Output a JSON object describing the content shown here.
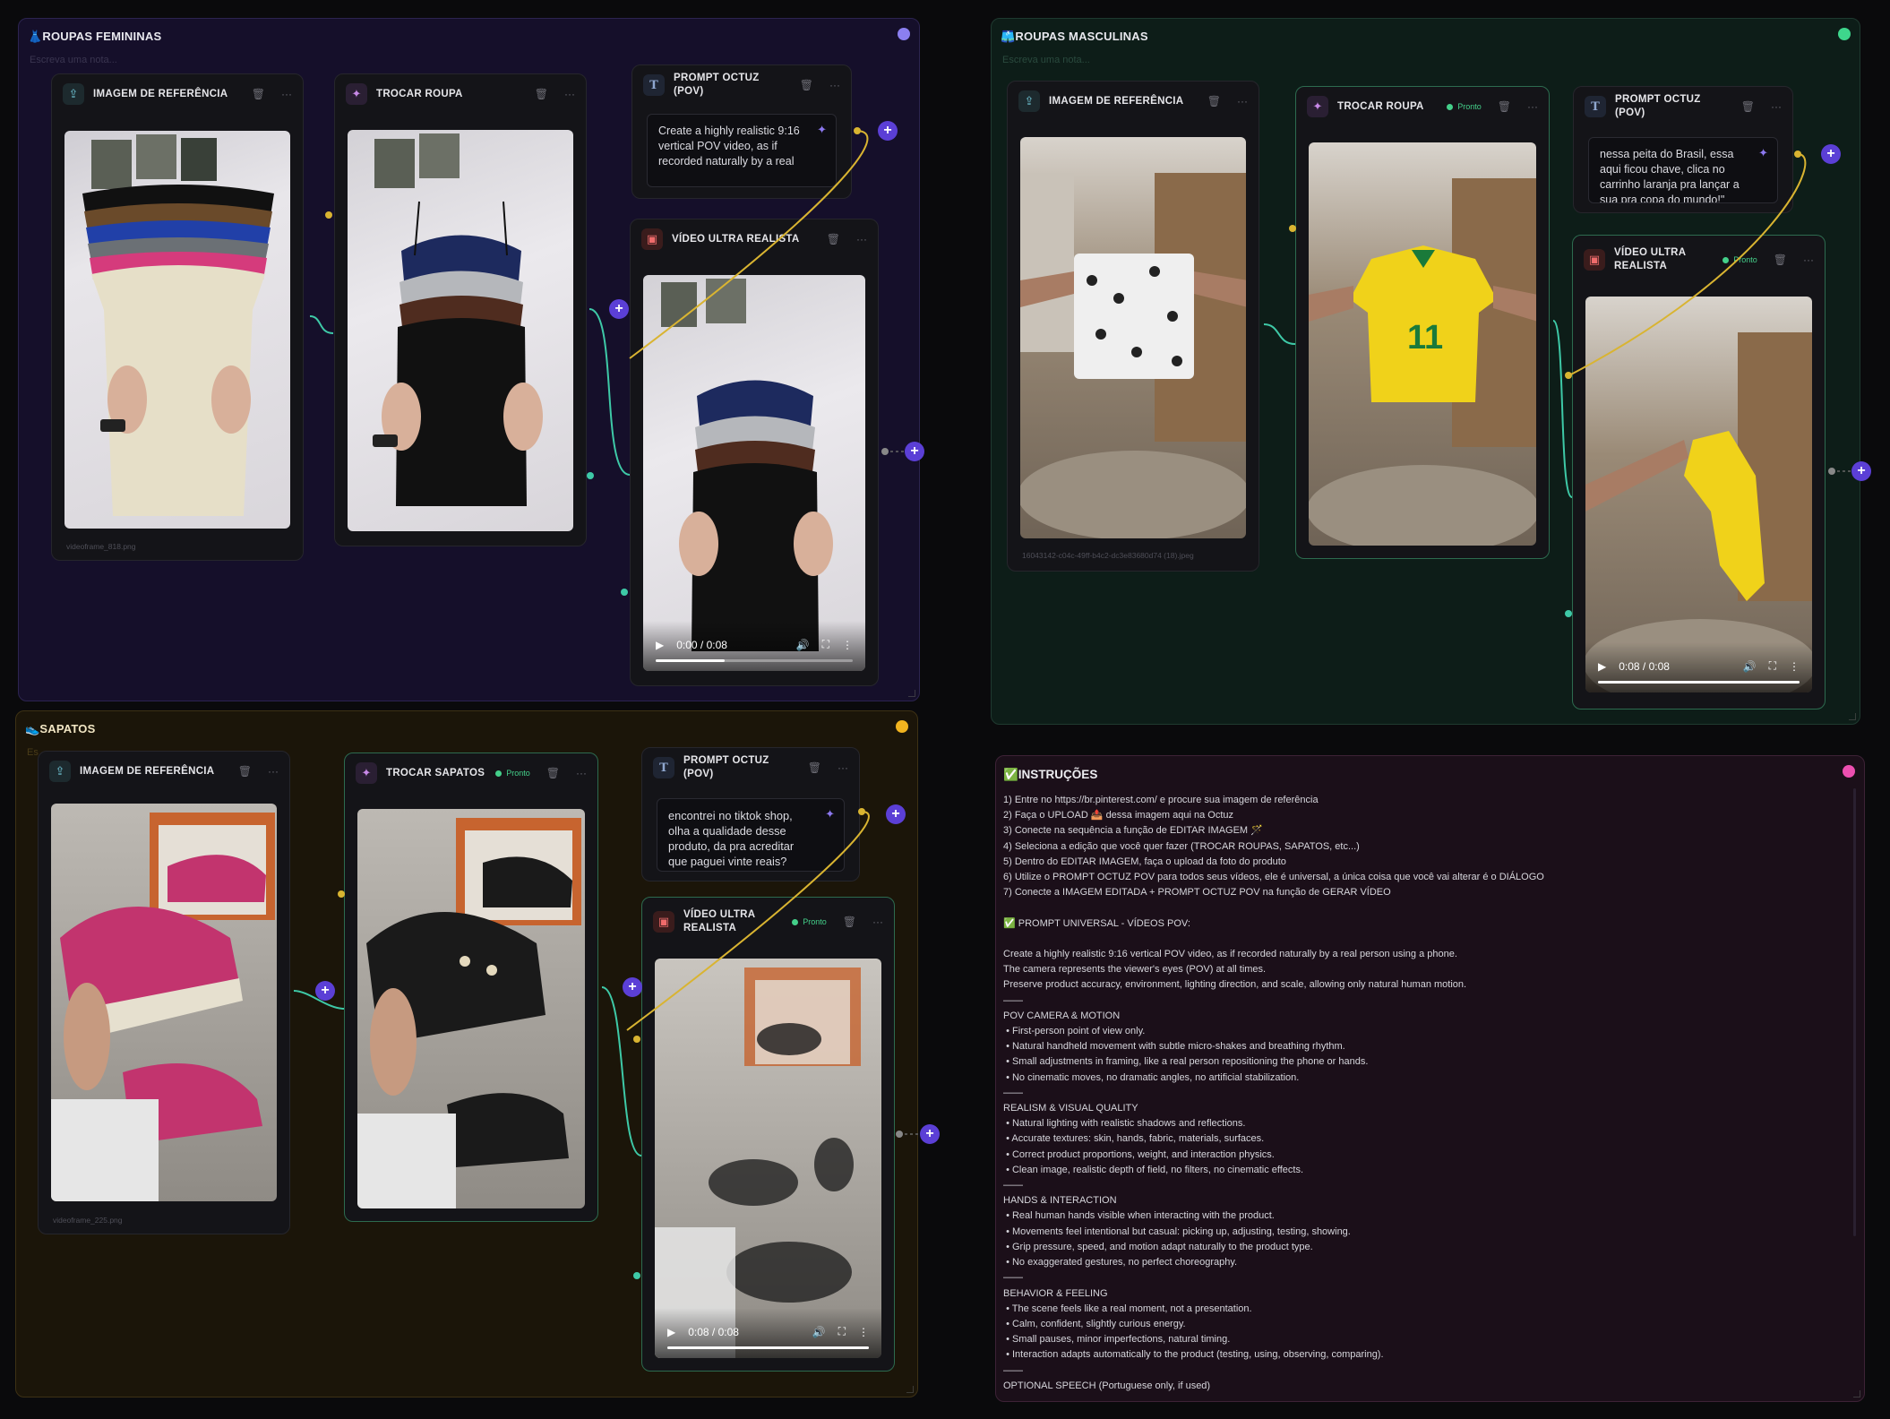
{
  "groups": {
    "feminine": {
      "title": "👗ROUPAS FEMININAS",
      "note": "Escreva uma nota...",
      "color": "#8b7ff0"
    },
    "masculine": {
      "title": "🩳ROUPAS MASCULINAS",
      "note": "Escreva uma nota...",
      "color": "#3ed68c"
    },
    "shoes": {
      "title": "👟SAPATOS",
      "note": "Es",
      "color": "#f1b31f"
    },
    "instructions": {
      "title": "✅INSTRUÇÕES",
      "color": "#ec4fb0"
    }
  },
  "nodes": {
    "fem_ref": {
      "title": "IMAGEM DE REFERÊNCIA",
      "caption": "videoframe_818.png"
    },
    "fem_swap": {
      "title": "TROCAR ROUPA"
    },
    "fem_prompt": {
      "title": "PROMPT OCTUZ (POV)",
      "text": "Create a highly realistic 9:16 vertical POV video, as if recorded naturally by a real"
    },
    "fem_video": {
      "title": "VÍDEO ULTRA REALISTA",
      "time": "0:00 / 0:08",
      "progress": 0.35
    },
    "masc_ref": {
      "title": "IMAGEM DE REFERÊNCIA",
      "caption": "16043142-c04c-49ff-b4c2-dc3e83680d74 (18).jpeg"
    },
    "masc_swap": {
      "title": "TROCAR ROUPA",
      "badge": "Pronto"
    },
    "masc_prompt": {
      "title": "PROMPT OCTUZ (POV)",
      "text": "nessa peita do Brasil, essa aqui ficou chave, clica no carrinho laranja pra lançar a sua pra copa do mundo!\""
    },
    "masc_video": {
      "title_line1": "VÍDEO ULTRA",
      "title_line2": "REALISTA",
      "badge": "Pronto",
      "time": "0:08 / 0:08",
      "progress": 1.0
    },
    "shoe_ref": {
      "title": "IMAGEM DE REFERÊNCIA",
      "caption": "videoframe_225.png"
    },
    "shoe_swap": {
      "title": "TROCAR SAPATOS",
      "badge": "Pronto"
    },
    "shoe_prompt": {
      "title": "PROMPT OCTUZ (POV)",
      "text": "encontrei no tiktok shop, olha a qualidade desse produto, da pra acreditar que paguei vinte reais? Clica no carrinho"
    },
    "shoe_video": {
      "title_line1": "VÍDEO ULTRA",
      "title_line2": "REALISTA",
      "badge": "Pronto",
      "time": "0:08 / 0:08",
      "progress": 1.0
    }
  },
  "instructions_text": "1) Entre no https://br.pinterest.com/ e procure sua imagem de referência\n2) Faça o UPLOAD 📤 dessa imagem aqui na Octuz\n3) Conecte na sequência a função de EDITAR IMAGEM 🪄\n4) Seleciona a edição que você quer fazer (TROCAR ROUPAS, SAPATOS, etc...)\n5) Dentro do EDITAR IMAGEM, faça o upload da foto do produto\n6) Utilize o PROMPT OCTUZ POV para todos seus vídeos, ele é universal, a única coisa que você vai alterar é o DIÁLOGO\n7) Conecte a IMAGEM EDITADA + PROMPT OCTUZ POV na função de GERAR VÍDEO\n\n✅ PROMPT UNIVERSAL - VÍDEOS POV:\n\nCreate a highly realistic 9:16 vertical POV video, as if recorded naturally by a real person using a phone.\nThe camera represents the viewer's eyes (POV) at all times.\nPreserve product accuracy, environment, lighting direction, and scale, allowing only natural human motion.\n——\nPOV CAMERA & MOTION\n • First-person point of view only.\n • Natural handheld movement with subtle micro-shakes and breathing rhythm.\n • Small adjustments in framing, like a real person repositioning the phone or hands.\n • No cinematic moves, no dramatic angles, no artificial stabilization.\n——\nREALISM & VISUAL QUALITY\n • Natural lighting with realistic shadows and reflections.\n • Accurate textures: skin, hands, fabric, materials, surfaces.\n • Correct product proportions, weight, and interaction physics.\n • Clean image, realistic depth of field, no filters, no cinematic effects.\n——\nHANDS & INTERACTION\n • Real human hands visible when interacting with the product.\n • Movements feel intentional but casual: picking up, adjusting, testing, showing.\n • Grip pressure, speed, and motion adapt naturally to the product type.\n • No exaggerated gestures, no perfect choreography.\n——\nBEHAVIOR & FEELING\n • The scene feels like a real moment, not a presentation.\n • Calm, confident, slightly curious energy.\n • Small pauses, minor imperfections, natural timing.\n • Interaction adapts automatically to the product (testing, using, observing, comparing).\n——\nOPTIONAL SPEECH (Portuguese only, if used)",
  "colors": {
    "wire_teal": "#3ec9a7",
    "wire_yellow": "#d9b431",
    "accent": "#5b3fd6",
    "ready": "#44d08a"
  },
  "icons": {
    "upload": "upload-icon",
    "wand": "magic-wand-icon",
    "text": "text-icon",
    "video": "film-icon",
    "trash": "trash-icon",
    "more": "more-icon",
    "plus": "add-icon"
  }
}
